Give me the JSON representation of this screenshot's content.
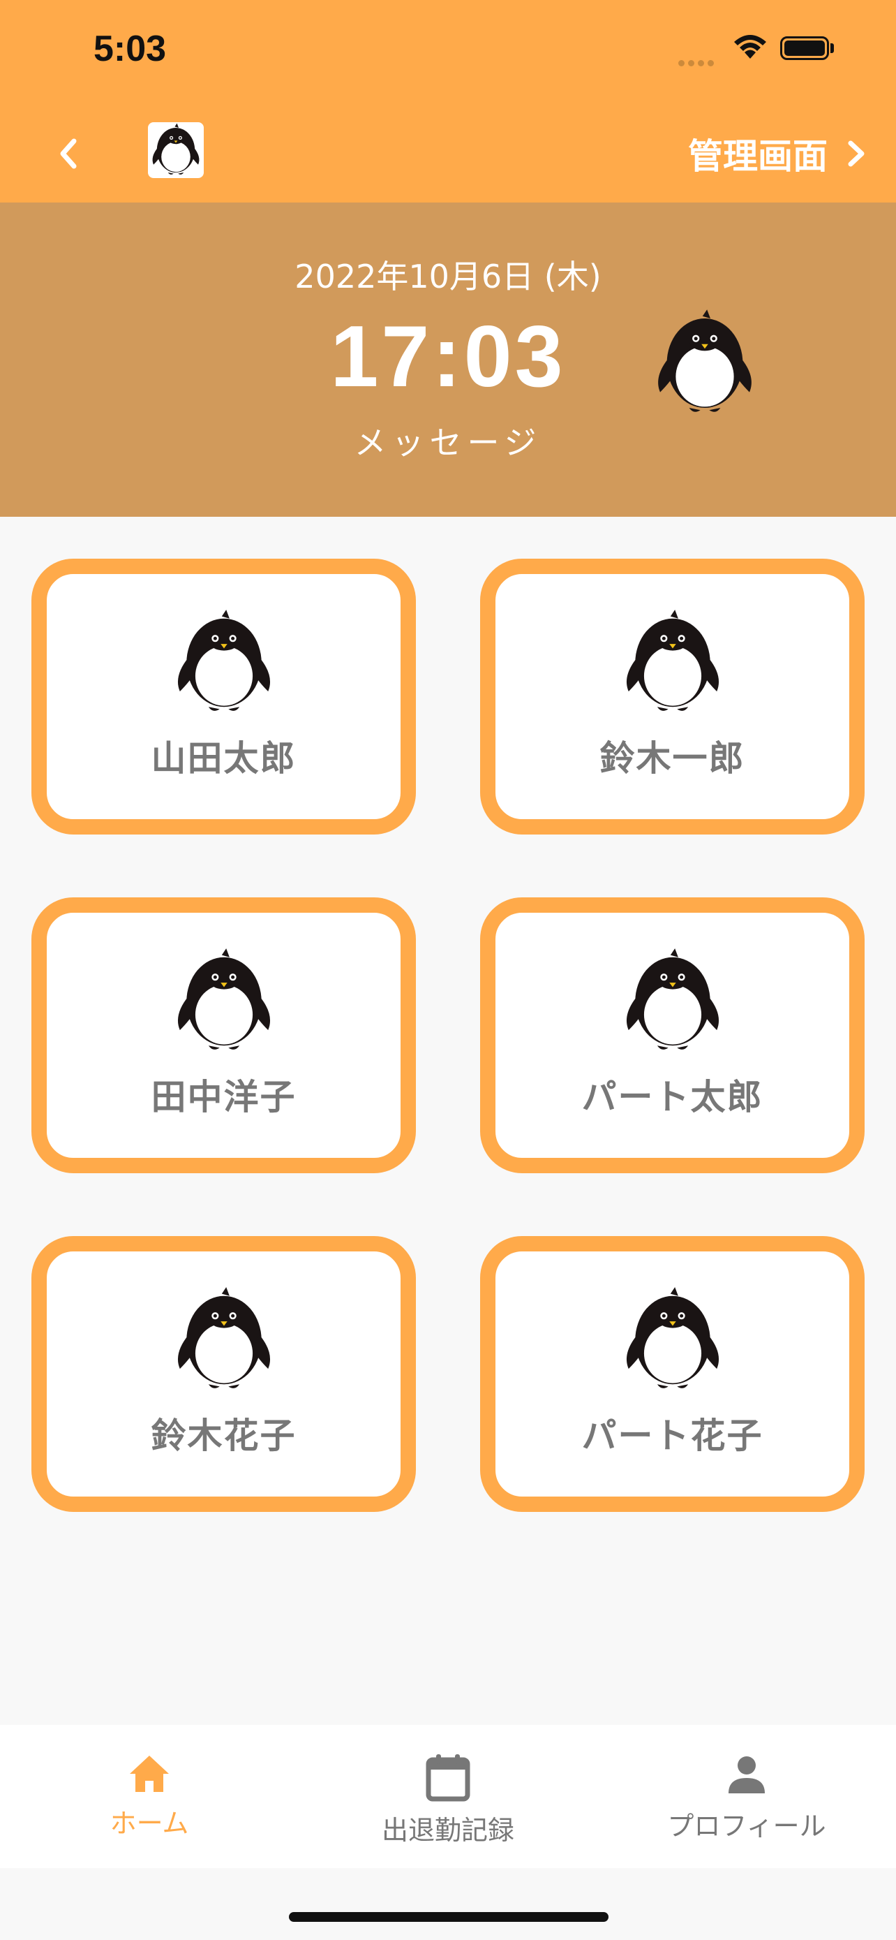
{
  "status_bar": {
    "time": "5:03"
  },
  "nav": {
    "admin_label": "管理画面"
  },
  "header": {
    "date": "2022年10月6日 (木)",
    "time": "17:03",
    "message": "メッセージ"
  },
  "employees": [
    {
      "name": "山田太郎"
    },
    {
      "name": "鈴木一郎"
    },
    {
      "name": "田中洋子"
    },
    {
      "name": "パート太郎"
    },
    {
      "name": "鈴木花子"
    },
    {
      "name": "パート花子"
    }
  ],
  "tabs": [
    {
      "label": "ホーム",
      "icon": "home-icon",
      "active": true
    },
    {
      "label": "出退勤記録",
      "icon": "calendar-icon",
      "active": false
    },
    {
      "label": "プロフィール",
      "icon": "person-icon",
      "active": false
    }
  ],
  "colors": {
    "accent": "#ffaa4a",
    "header_panel": "#d19a5b",
    "background": "#f8f8f8",
    "name_text": "#777777",
    "tab_inactive": "#777777"
  }
}
